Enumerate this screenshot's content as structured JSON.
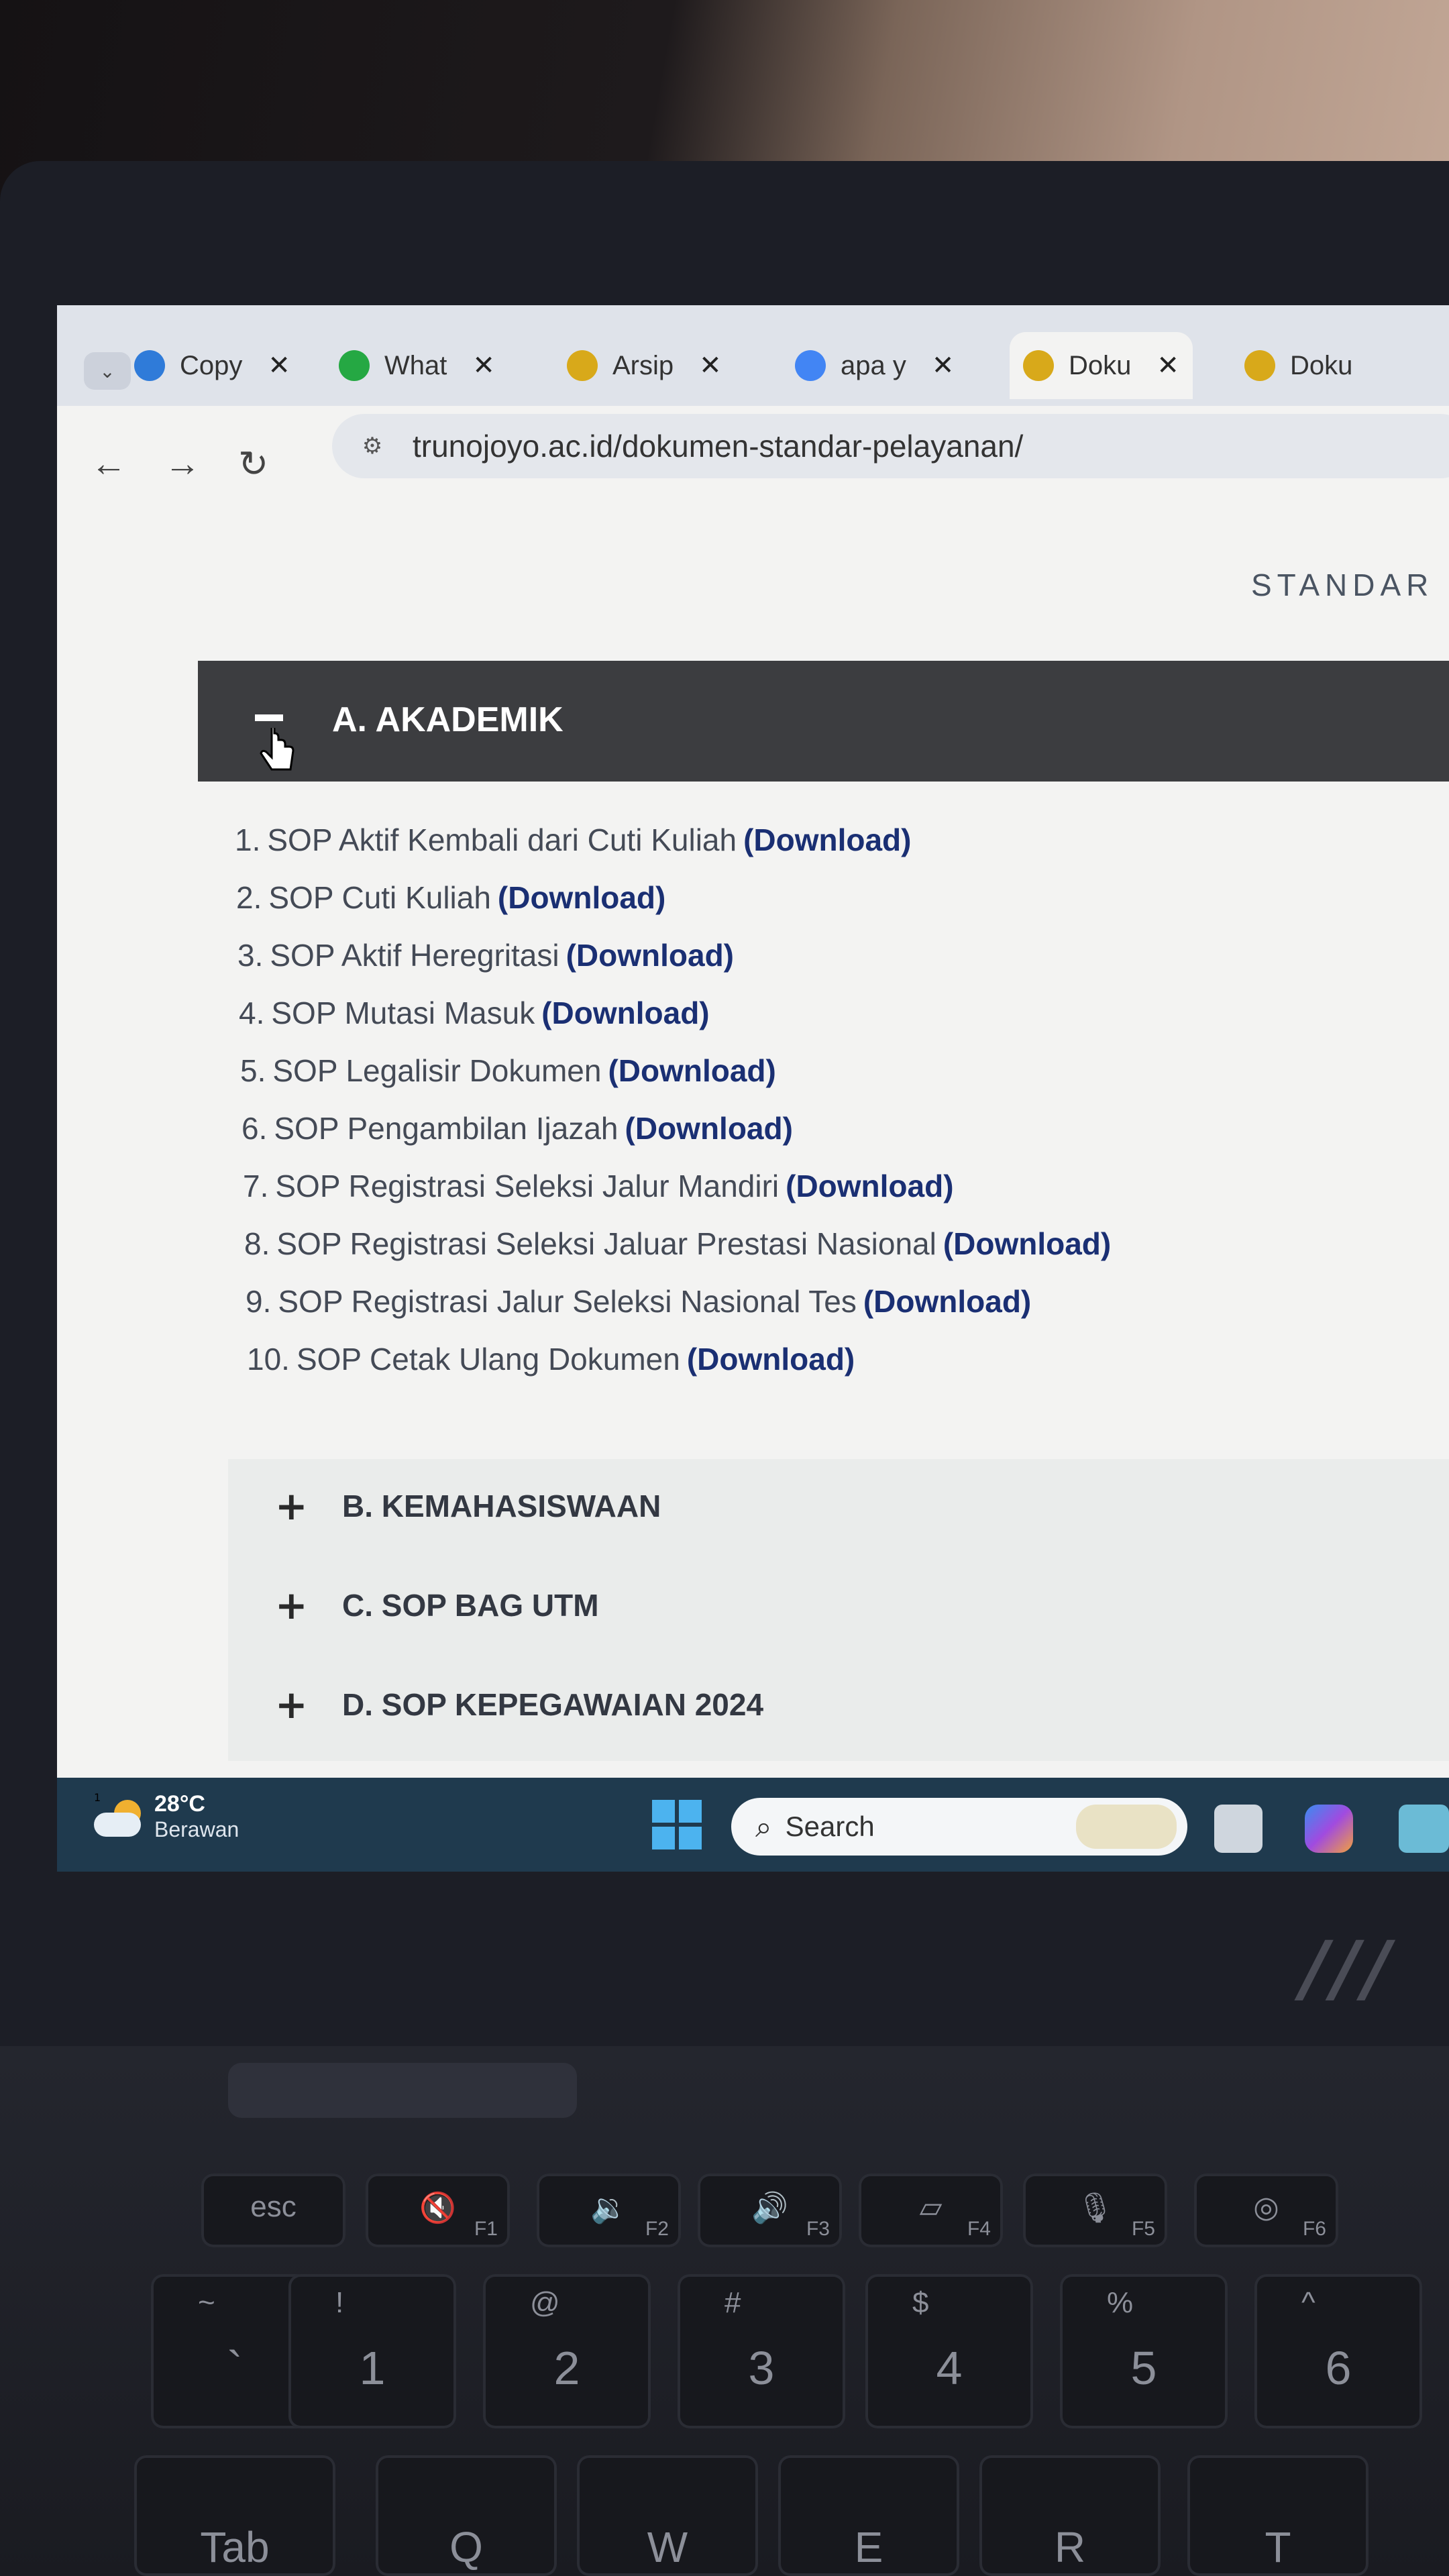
{
  "browser": {
    "tabs": [
      {
        "label": "Copy",
        "icon": "drive-icon",
        "color": "#2f7bd9"
      },
      {
        "label": "What",
        "icon": "whatsapp-icon",
        "color": "#25a843"
      },
      {
        "label": "Arsip",
        "icon": "utm-logo-icon",
        "color": "#d8a91a"
      },
      {
        "label": "apa y",
        "icon": "google-icon",
        "color": "#4285f4"
      },
      {
        "label": "Doku",
        "icon": "utm-logo-icon",
        "color": "#d8a91a",
        "active": true
      },
      {
        "label": "Doku",
        "icon": "utm-logo-icon",
        "color": "#d8a91a"
      }
    ],
    "close_glyph": "✕",
    "dropdown_glyph": "⌄",
    "url": "trunojoyo.ac.id/dokumen-standar-pelayanan/"
  },
  "page": {
    "header_partial": "STANDAR",
    "section_a": {
      "title": "A. AKADEMIK",
      "items": [
        {
          "num": "1.",
          "text": "SOP Aktif Kembali dari Cuti Kuliah",
          "link": "(Download)"
        },
        {
          "num": "2.",
          "text": "SOP Cuti Kuliah",
          "link": "(Download)"
        },
        {
          "num": "3.",
          "text": "SOP Aktif Heregritasi",
          "link": "(Download)"
        },
        {
          "num": "4.",
          "text": "SOP Mutasi Masuk",
          "link": "(Download)"
        },
        {
          "num": "5.",
          "text": "SOP Legalisir Dokumen",
          "link": "(Download)"
        },
        {
          "num": "6.",
          "text": "SOP Pengambilan Ijazah",
          "link": "(Download)"
        },
        {
          "num": "7.",
          "text": "SOP Registrasi Seleksi Jalur Mandiri",
          "link": "(Download)"
        },
        {
          "num": "8.",
          "text": "SOP Registrasi Seleksi Jaluar Prestasi Nasional",
          "link": "(Download)"
        },
        {
          "num": "9.",
          "text": "SOP Registrasi Jalur Seleksi Nasional Tes",
          "link": "(Download)"
        },
        {
          "num": "10.",
          "text": "SOP Cetak Ulang Dokumen",
          "link": "(Download)"
        }
      ]
    },
    "collapsed_sections": [
      {
        "title": "B. KEMAHASISWAAN"
      },
      {
        "title": "C. SOP BAG UTM"
      },
      {
        "title": "D. SOP KEPEGAWAIAN 2024"
      }
    ]
  },
  "taskbar": {
    "weather_temp": "28°C",
    "weather_condition": "Berawan",
    "notification_count": "1",
    "search_label": "Search"
  },
  "keyboard": {
    "fn_row": [
      {
        "main": "esc",
        "sub": ""
      },
      {
        "main": "🔇",
        "sub": "F1"
      },
      {
        "main": "🔉",
        "sub": "F2"
      },
      {
        "main": "🔊",
        "sub": "F3"
      },
      {
        "main": "▱",
        "sub": "F4"
      },
      {
        "main": "🎙",
        "sub": "F5"
      },
      {
        "main": "◎",
        "sub": "F6"
      }
    ],
    "num_row": [
      {
        "main": "`",
        "top": "~"
      },
      {
        "main": "1",
        "top": "!"
      },
      {
        "main": "2",
        "top": "@"
      },
      {
        "main": "3",
        "top": "#"
      },
      {
        "main": "4",
        "top": "$"
      },
      {
        "main": "5",
        "top": "%"
      },
      {
        "main": "6",
        "top": "^"
      }
    ],
    "letter_row": [
      "Tab",
      "Q",
      "W",
      "E",
      "R",
      "T"
    ]
  }
}
